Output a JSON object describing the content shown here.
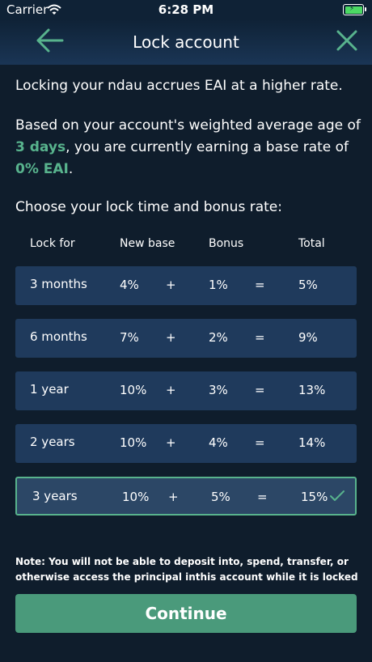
{
  "status_bar": {
    "carrier": "Carrier",
    "time": "6:28 PM",
    "icons": [
      "wifi-icon",
      "battery-icon"
    ]
  },
  "nav": {
    "title": "Lock account",
    "back_icon": "arrow-left-icon",
    "close_icon": "close-icon",
    "icon_color": "#58b38d"
  },
  "content": {
    "intro": "Locking your ndau accrues EAI at a higher rate.",
    "rate_info": {
      "prefix": "Based on your account's weighted average age of ",
      "age": "3 days",
      "middle": ", you are currently earning a base rate of ",
      "rate": "0% EAI",
      "suffix": "."
    },
    "choose_label": "Choose your lock time and bonus rate:"
  },
  "table": {
    "headers": {
      "lock_for": "Lock for",
      "new_base": "New base",
      "bonus": "Bonus",
      "total": "Total"
    },
    "rows": [
      {
        "lock_for": "3 months",
        "new_base": "4%",
        "plus": "+",
        "bonus": "1%",
        "equals": "=",
        "total": "5%",
        "selected": false
      },
      {
        "lock_for": "6 months",
        "new_base": "7%",
        "plus": "+",
        "bonus": "2%",
        "equals": "=",
        "total": "9%",
        "selected": false
      },
      {
        "lock_for": "1 year",
        "new_base": "10%",
        "plus": "+",
        "bonus": "3%",
        "equals": "=",
        "total": "13%",
        "selected": false
      },
      {
        "lock_for": "2 years",
        "new_base": "10%",
        "plus": "+",
        "bonus": "4%",
        "equals": "=",
        "total": "14%",
        "selected": false
      },
      {
        "lock_for": "3 years",
        "new_base": "10%",
        "plus": "+",
        "bonus": "5%",
        "equals": "=",
        "total": "15%",
        "selected": true
      }
    ]
  },
  "note": "Note: You will not be able to deposit into, spend, transfer, or otherwise access the principal inthis account while it is locked",
  "continue_label": "Continue",
  "colors": {
    "background": "#0f1d2c",
    "row": "#1f3a5c",
    "selected_row": "#2c4766",
    "accent": "#58b38d",
    "button": "#4a9a7b"
  }
}
